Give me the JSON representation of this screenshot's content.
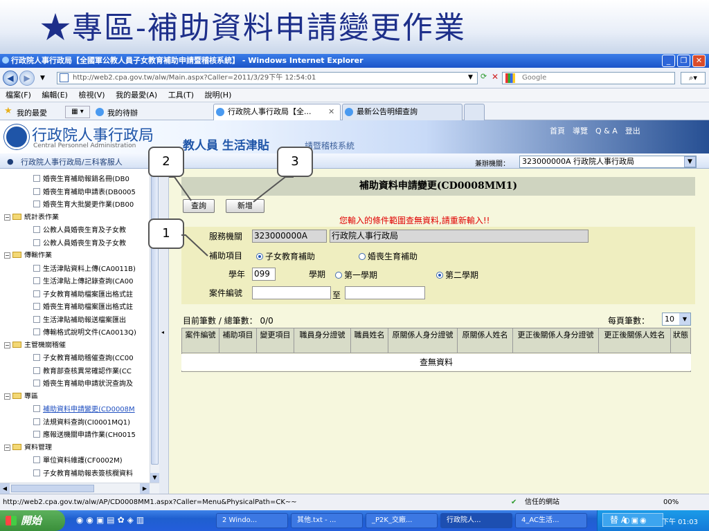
{
  "slide": {
    "title": "★專區-補助資料申請變更作業"
  },
  "browser": {
    "window_title": "行政院人事行政局【全國軍公教人員子女教育補助申請暨稽核系統】 - Windows Internet Explorer",
    "url": "http://web2.cpa.gov.tw/alw/Main.aspx?Caller=2011/3/29下午 12:54:01",
    "search_placeholder": "Google",
    "menu": [
      "檔案(F)",
      "編輯(E)",
      "檢視(V)",
      "我的最愛(A)",
      "工具(T)",
      "說明(H)"
    ],
    "favorites_label": "我的最愛",
    "favorites_link": "我的待辦",
    "tabs": [
      "行政院人事行政局【全...",
      "最新公告明細查詢"
    ],
    "status_url": "http://web2.cpa.gov.tw/alw/AP/CD0008MM1.aspx?Caller=Menu&PhysicalPath=CK~~",
    "trusted_label": "信任的網站",
    "zoom": "00%"
  },
  "site": {
    "name": "行政院人事行政局",
    "name_en": "Central Personnel Administration",
    "banner_sub": "教人員 生活津貼",
    "banner_sys": "請暨稽核系統",
    "top_links": "首頁　導覽　Q & A　登出",
    "breadcrumb": "行政院人事行政局/三科客服人",
    "agency_label": "兼辦機關：",
    "agency_value": "323000000A 行政院人事行政局"
  },
  "tree": [
    {
      "text": "婚喪生育補助報銷名冊(DB0",
      "kind": "file",
      "indent": 1
    },
    {
      "text": "婚喪生育補助申請表(DB0005",
      "kind": "file",
      "indent": 1
    },
    {
      "text": "婚喪生育大批變更作業(DB00",
      "kind": "file",
      "indent": 1
    },
    {
      "text": "統計表作業",
      "kind": "folder",
      "indent": 0
    },
    {
      "text": "公教人員婚喪生育及子女教",
      "kind": "file",
      "indent": 1
    },
    {
      "text": "公教人員婚喪生育及子女教",
      "kind": "file",
      "indent": 1
    },
    {
      "text": "傳輸作業",
      "kind": "folder",
      "indent": 0
    },
    {
      "text": "生活津貼資料上傳(CA0011B)",
      "kind": "file",
      "indent": 1
    },
    {
      "text": "生活津貼上傳記錄查詢(CA00",
      "kind": "file",
      "indent": 1
    },
    {
      "text": "子女教育補助檔案匯出格式註",
      "kind": "file",
      "indent": 1
    },
    {
      "text": "婚喪生育補助檔案匯出格式註",
      "kind": "file",
      "indent": 1
    },
    {
      "text": "生活津貼補助報送檔案匯出",
      "kind": "file",
      "indent": 1
    },
    {
      "text": "傳輸格式說明文件(CA0013Q)",
      "kind": "file",
      "indent": 1
    },
    {
      "text": "主管機關稽催",
      "kind": "folder",
      "indent": 0
    },
    {
      "text": "子女教育補助稽催查詢(CC00",
      "kind": "file",
      "indent": 1
    },
    {
      "text": "教育部查核異常確認作業(CC",
      "kind": "file",
      "indent": 1
    },
    {
      "text": "婚喪生育補助申請狀況查詢及",
      "kind": "file",
      "indent": 1
    },
    {
      "text": "專區",
      "kind": "folder",
      "indent": 0
    },
    {
      "text": "補助資料申請變更(CD0008M",
      "kind": "file",
      "indent": 1,
      "active": true
    },
    {
      "text": "法規資料查詢(CI0001MQ1)",
      "kind": "file",
      "indent": 1
    },
    {
      "text": "應報送機關申請作業(CH0015",
      "kind": "file",
      "indent": 1
    },
    {
      "text": "資料管理",
      "kind": "folder",
      "indent": 0
    },
    {
      "text": "單位資料維護(CF0002M)",
      "kind": "file",
      "indent": 1
    },
    {
      "text": "子女教育補助報表簽核欄資料",
      "kind": "file",
      "indent": 1
    }
  ],
  "page": {
    "title": "補助資料申請變更(CD0008MM1)",
    "query_button": "查詢",
    "add_button": "新增",
    "error": "您輸入的條件範圍查無資料,請重新輸入!!",
    "service_label": "服務機關",
    "service_code": "323000000A",
    "service_name": "行政院人事行政局",
    "subsidy_label": "補助項目",
    "subsidy_opt1": "子女教育補助",
    "subsidy_opt2": "婚喪生育補助",
    "year_label": "學年",
    "year_value": "099",
    "term_label": "學期",
    "term_opt1": "第一學期",
    "term_opt2": "第二學期",
    "case_label": "案件編號",
    "case_to": "至",
    "count_label": "目前筆數 / 總筆數： 0/0",
    "perpage_label": "每頁筆數：",
    "perpage_value": "10",
    "columns": [
      "案件編號",
      "補助項目",
      "變更項目",
      "職員身分證號",
      "職員姓名",
      "原關係人身分證號",
      "原關係人姓名",
      "更正後關係人身分證號",
      "更正後關係人姓名",
      "狀態"
    ],
    "no_data": "查無資料"
  },
  "callouts": [
    "1",
    "2",
    "3"
  ],
  "taskbar": {
    "start": "開始",
    "tasks": [
      "2 Windo...",
      "其他.txt - ...",
      "_P2K_交廠...",
      "行政院人...",
      "4_AC生活..."
    ],
    "ime": "替 A",
    "clock": "下午 01:03"
  }
}
